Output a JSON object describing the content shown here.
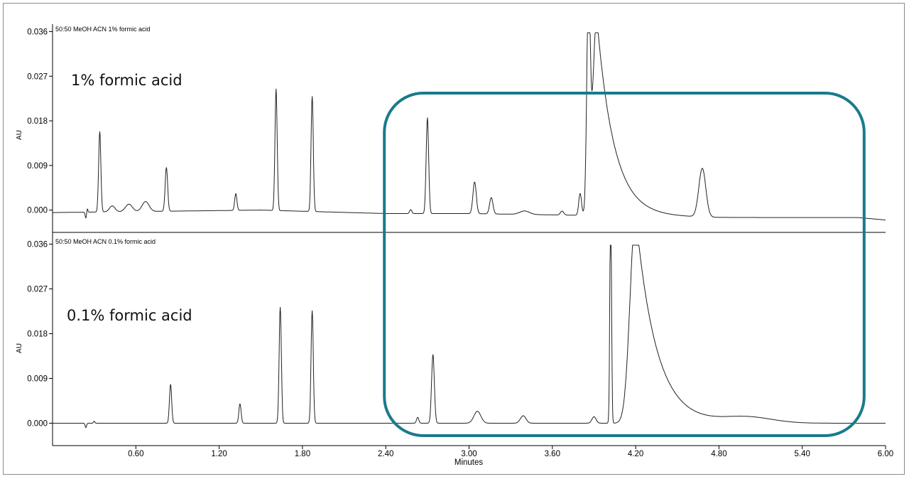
{
  "chart_data": [
    {
      "type": "line",
      "title": "50:50 MeOH ACN 1% formic acid",
      "annotation": "1% formic acid",
      "ylabel": "AU",
      "xlabel": "",
      "xlim": [
        0.0,
        6.0
      ],
      "ylim": [
        -0.0045,
        0.0375
      ],
      "yticks": [
        "0.000",
        "0.009",
        "0.018",
        "0.027",
        "0.036"
      ],
      "yticks_values": [
        0.0,
        0.009,
        0.018,
        0.027,
        0.036
      ],
      "baseline": [
        [
          0.0,
          -0.0005
        ],
        [
          1.5,
          0.0
        ],
        [
          2.4,
          -0.0007
        ],
        [
          3.0,
          -0.0007
        ],
        [
          4.8,
          -0.0015
        ],
        [
          5.8,
          -0.0015
        ],
        [
          6.0,
          -0.002
        ]
      ],
      "peaks": [
        {
          "rt": 0.24,
          "height": -0.0012,
          "width": 0.005
        },
        {
          "rt": 0.25,
          "height": 0.0008,
          "width": 0.004
        },
        {
          "rt": 0.34,
          "height": 0.0162,
          "width": 0.008
        },
        {
          "rt": 0.43,
          "height": 0.0012,
          "width": 0.02
        },
        {
          "rt": 0.55,
          "height": 0.0015,
          "width": 0.025
        },
        {
          "rt": 0.67,
          "height": 0.002,
          "width": 0.025
        },
        {
          "rt": 0.82,
          "height": 0.0088,
          "width": 0.009
        },
        {
          "rt": 1.32,
          "height": 0.0034,
          "width": 0.008
        },
        {
          "rt": 1.61,
          "height": 0.0245,
          "width": 0.008
        },
        {
          "rt": 1.87,
          "height": 0.0232,
          "width": 0.008
        },
        {
          "rt": 2.58,
          "height": 0.0008,
          "width": 0.008
        },
        {
          "rt": 2.7,
          "height": 0.0193,
          "width": 0.009
        },
        {
          "rt": 3.04,
          "height": 0.0064,
          "width": 0.012
        },
        {
          "rt": 3.16,
          "height": 0.0033,
          "width": 0.012
        },
        {
          "rt": 3.4,
          "height": 0.0007,
          "width": 0.035
        },
        {
          "rt": 3.67,
          "height": 0.0008,
          "width": 0.012
        },
        {
          "rt": 3.8,
          "height": 0.0044,
          "width": 0.01
        },
        {
          "rt": 3.86,
          "height": 0.043,
          "width": 0.012
        },
        {
          "rt": 3.92,
          "height": 0.04,
          "width": 0.03,
          "tail": 0.35
        },
        {
          "rt": 4.68,
          "height": 0.0098,
          "width": 0.025
        }
      ]
    },
    {
      "type": "line",
      "title": "50:50 MeOH ACN 0.1% formic acid",
      "annotation": "0.1% formic acid",
      "ylabel": "AU",
      "xlabel": "Minutes",
      "xlim": [
        0.0,
        6.0
      ],
      "ylim": [
        -0.0045,
        0.0375
      ],
      "yticks": [
        "0.000",
        "0.009",
        "0.018",
        "0.027",
        "0.036"
      ],
      "yticks_values": [
        0.0,
        0.009,
        0.018,
        0.027,
        0.036
      ],
      "xticks": [
        "0.60",
        "1.20",
        "1.80",
        "2.40",
        "3.00",
        "3.60",
        "4.20",
        "4.80",
        "5.40",
        "6.00"
      ],
      "xticks_values": [
        0.6,
        1.2,
        1.8,
        2.4,
        3.0,
        3.6,
        4.2,
        4.8,
        5.4,
        6.0
      ],
      "baseline": [
        [
          0.0,
          0.0
        ],
        [
          6.0,
          0.0
        ]
      ],
      "peaks": [
        {
          "rt": 0.24,
          "height": -0.0009,
          "width": 0.005
        },
        {
          "rt": 0.3,
          "height": 0.0004,
          "width": 0.005
        },
        {
          "rt": 0.85,
          "height": 0.0078,
          "width": 0.008
        },
        {
          "rt": 1.35,
          "height": 0.0039,
          "width": 0.008
        },
        {
          "rt": 1.64,
          "height": 0.0233,
          "width": 0.008
        },
        {
          "rt": 1.87,
          "height": 0.0226,
          "width": 0.008
        },
        {
          "rt": 2.63,
          "height": 0.0012,
          "width": 0.008
        },
        {
          "rt": 2.74,
          "height": 0.0138,
          "width": 0.01
        },
        {
          "rt": 3.06,
          "height": 0.0024,
          "width": 0.025
        },
        {
          "rt": 3.39,
          "height": 0.0015,
          "width": 0.02
        },
        {
          "rt": 3.9,
          "height": 0.0013,
          "width": 0.015
        },
        {
          "rt": 4.02,
          "height": 0.045,
          "width": 0.006
        },
        {
          "rt": 4.2,
          "height": 0.042,
          "width": 0.04,
          "tail": 0.42
        },
        {
          "rt": 5.0,
          "height": 0.0012,
          "width": 0.18
        }
      ]
    }
  ],
  "highlight": {
    "color": "#1a7a8c",
    "x_range": [
      2.4,
      5.82
    ]
  }
}
